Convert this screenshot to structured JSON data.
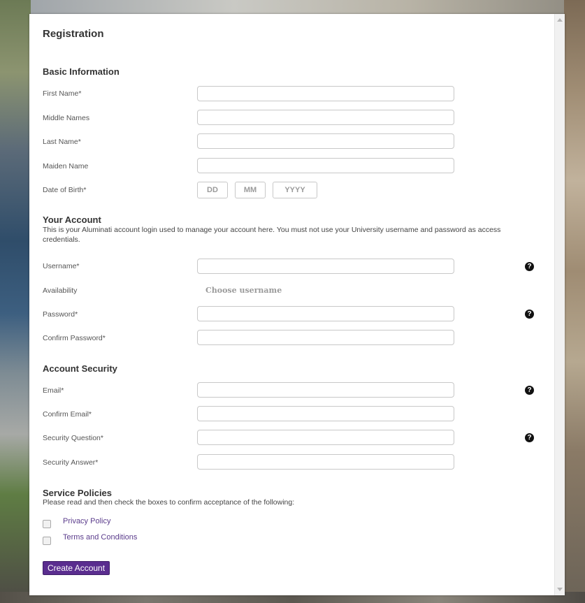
{
  "page": {
    "title": "Registration"
  },
  "basic": {
    "title": "Basic Information",
    "first_name": {
      "label": "First Name*",
      "value": ""
    },
    "middle_names": {
      "label": "Middle Names",
      "value": ""
    },
    "last_name": {
      "label": "Last Name*",
      "value": ""
    },
    "maiden_name": {
      "label": "Maiden Name",
      "value": ""
    },
    "dob": {
      "label": "Date of Birth*",
      "day_placeholder": "DD",
      "month_placeholder": "MM",
      "year_placeholder": "YYYY"
    }
  },
  "account": {
    "title": "Your Account",
    "description": "This is your Aluminati account login used to manage your account here. You must not use your University username and password as access credentials.",
    "username": {
      "label": "Username*",
      "value": ""
    },
    "availability": {
      "label": "Availability",
      "status": "Choose username"
    },
    "password": {
      "label": "Password*",
      "value": ""
    },
    "confirm_password": {
      "label": "Confirm Password*",
      "value": ""
    }
  },
  "security": {
    "title": "Account Security",
    "email": {
      "label": "Email*",
      "value": ""
    },
    "confirm_email": {
      "label": "Confirm Email*",
      "value": ""
    },
    "question": {
      "label": "Security Question*",
      "value": ""
    },
    "answer": {
      "label": "Security Answer*",
      "value": ""
    }
  },
  "policies": {
    "title": "Service Policies",
    "description": "Please read and then check the boxes to confirm acceptance of the following:",
    "privacy": {
      "label": "Privacy Policy",
      "checked": false
    },
    "terms": {
      "label": "Terms and Conditions",
      "checked": false
    }
  },
  "actions": {
    "create_label": "Create Account"
  },
  "icons": {
    "help": "question-mark-circle-icon"
  },
  "colors": {
    "accent": "#5a2d8f",
    "link": "#5b3c8c"
  }
}
